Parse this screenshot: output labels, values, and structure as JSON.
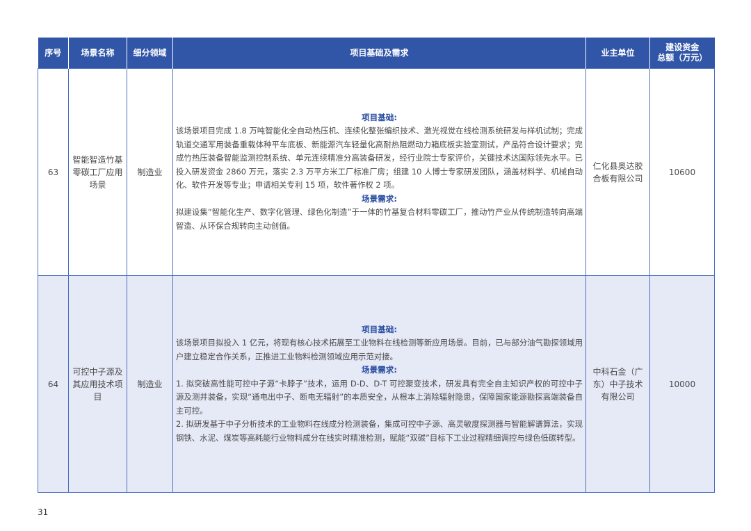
{
  "table": {
    "headers": {
      "index": "序号",
      "scene_name": "场景名称",
      "sub_field": "细分领域",
      "basis_and_demand": "项目基础及需求",
      "owner": "业主单位",
      "investment_line1": "建设资金",
      "investment_line2": "总额（万元）"
    },
    "rows": [
      {
        "index": "63",
        "scene_name": "智能智造竹基零碳工厂应用场景",
        "sub_field": "制造业",
        "basis_label": "项目基础:",
        "basis_paragraphs": [
          "该场景项目完成 1.8 万吨智能化全自动热压机、连续化整张编织技术、激光视觉在线检测系统研发与样机试制；完成轨道交通军用装备重载体种平车底板、新能源汽车轻量化高耐热阻燃动力箱底板实验室测试，产品符合设计要求；完成竹热压装备智能监测控制系统、单元连续精准分高装备研发，经行业院士专家评价，关键技术达国际领先水平。已投入研发资金 2860 万元，落实 2.3 万平方米工厂标准厂房；组建 10 人博士专家研发团队，涵盖材料学、机械自动化、软件开发等专业；申请相关专利 15 项，软件著作权 2 项。"
        ],
        "demand_label": "场景需求:",
        "demand_paragraphs": [
          "拟建设集“智能化生产、数字化管理、绿色化制造”于一体的竹基复合材料零碳工厂，推动竹产业从传统制造转向高端智造、从环保合规转向主动创值。"
        ],
        "owner": "仁化县奥达胶合板有限公司",
        "investment": "10600"
      },
      {
        "index": "64",
        "scene_name": "可控中子源及其应用技术项目",
        "sub_field": "制造业",
        "basis_label": "项目基础:",
        "basis_paragraphs": [
          "该场景项目拟投入 1 亿元，将现有核心技术拓展至工业物料在线检测等新应用场景。目前，已与部分油气勘探领域用户建立稳定合作关系，正推进工业物料检测领域应用示范对接。"
        ],
        "demand_label": "场景需求:",
        "demand_paragraphs": [
          "1. 拟突破高性能可控中子源“卡脖子”技术，运用 D-D、D-T 可控聚变技术，研发具有完全自主知识产权的可控中子源及测井装备，实现“通电出中子、断电无辐射”的本质安全，从根本上消除辐射隐患，保障国家能源勘探高端装备自主可控。",
          "2. 拟研发基于中子分析技术的工业物料在线成分检测装备，集成可控中子源、高灵敏度探测器与智能解谱算法，实现钢铁、水泥、煤炭等高耗能行业物料成分在线实时精准检测，赋能“双碳”目标下工业过程精细调控与绿色低碳转型。"
        ],
        "owner": "中科石金（广东）中子技术有限公司",
        "investment": "10000"
      }
    ]
  },
  "page_number": "31",
  "colors": {
    "header_bg": "#3156a8",
    "accent_text": "#2a4ea0",
    "alt_row_bg": "#e6e9f6",
    "border": "#4a6fbf"
  }
}
